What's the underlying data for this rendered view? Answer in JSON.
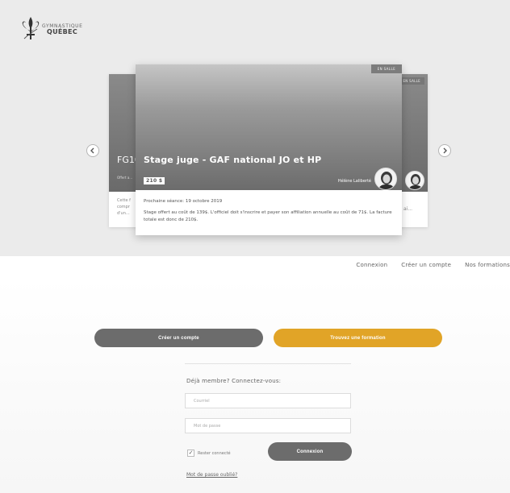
{
  "brand": {
    "line1": "GYMNASTIQUE",
    "line2": "QUÉBEC"
  },
  "carousel": {
    "prev_arrow": "‹",
    "next_arrow": "›",
    "main_card": {
      "badge": "EN SALLE",
      "title": "Stage juge - GAF national JO et HP",
      "price": "210 $",
      "instructor": "Hélène Laliberté",
      "next_session": "Prochaine séance: 19 octobre 2019",
      "description": "Stage offert au coût de 139$. L'officiel doit s'inscrire et payer son affiliation annuelle au coût de 71$. La facture totale est donc de 210$."
    },
    "left_card": {
      "title": "FG10",
      "subtitle": "Offert a...",
      "description_line1": "Cette f",
      "description_line2": "compr",
      "description_line3": "d'un..."
    },
    "right_card": {
      "badge": "EN SALLE",
      "ellipsis": "ai..."
    }
  },
  "nav": {
    "login": "Connexion",
    "create_account": "Créer un compte",
    "trainings": "Nos formations"
  },
  "actions": {
    "create_account": "Créer un compte",
    "find_training": "Trouvez une formation"
  },
  "login": {
    "heading": "Déjà membre? Connectez-vous:",
    "email_placeholder": "Courriel",
    "password_placeholder": "Mot de passe",
    "remember_checked": true,
    "remember_label": "Rester connecté",
    "check_mark": "✓",
    "submit": "Connexion",
    "forgot": "Mot de passe oublié?"
  },
  "colors": {
    "accent": "#e1a427",
    "dark_button": "#6c6c6c",
    "hero_bg": "#ebebeb"
  }
}
